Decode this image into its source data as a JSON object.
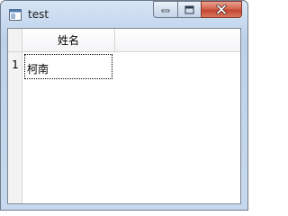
{
  "window": {
    "title": "test"
  },
  "table": {
    "columns": [
      "姓名"
    ],
    "rows": [
      {
        "number": "1",
        "cells": [
          "柯南"
        ]
      }
    ]
  },
  "icons": {
    "app": "window-app-icon",
    "minimize": "minimize-icon",
    "maximize": "maximize-icon",
    "close": "close-icon"
  },
  "colors": {
    "close_button": "#c9442e",
    "title_bar": "#c6d9ee"
  }
}
